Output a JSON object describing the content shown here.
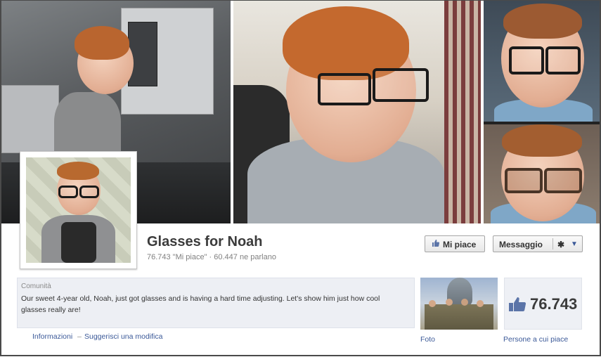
{
  "page": {
    "title": "Glasses for Noah",
    "stats": "76.743 \"Mi piace\" · 60.447 ne parlano"
  },
  "buttons": {
    "like_label": "Mi piace",
    "message_label": "Messaggio"
  },
  "about": {
    "category": "Comunità",
    "description": "Our sweet 4-year old, Noah, just got glasses and is having a hard time adjusting. Let's show him just how cool glasses really are!"
  },
  "links": {
    "info": "Informazioni",
    "separator": "–",
    "suggest": "Suggerisci una modifica"
  },
  "tiles": {
    "photos_caption": "Foto",
    "likes_count": "76.743",
    "likes_caption": "Persone a cui piace"
  },
  "icons": {
    "like": "thumbs-up-icon",
    "settings": "gear-icon",
    "dropdown": "caret-down-icon"
  },
  "colors": {
    "link": "#3b5998",
    "about_bg": "#edeff4"
  }
}
